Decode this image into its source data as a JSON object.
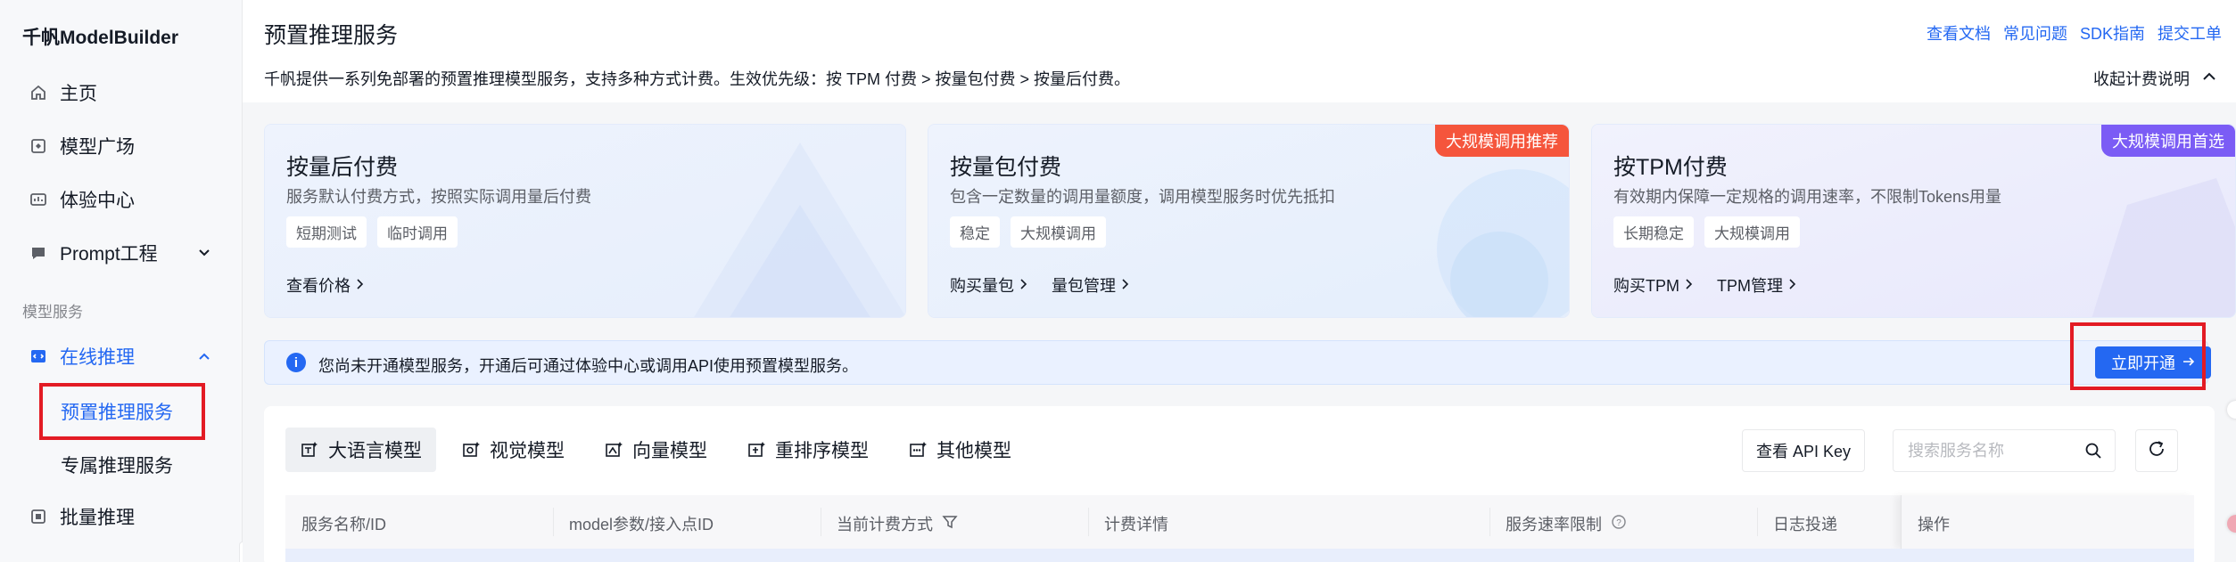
{
  "sidebar": {
    "brand": "千帆ModelBuilder",
    "items": [
      {
        "label": "主页",
        "icon": "home-icon"
      },
      {
        "label": "模型广场",
        "icon": "model-square-icon"
      },
      {
        "label": "体验中心",
        "icon": "experience-icon"
      },
      {
        "label": "Prompt工程",
        "icon": "prompt-icon"
      }
    ],
    "section_label": "模型服务",
    "online_inference": {
      "label": "在线推理",
      "icon": "code-icon"
    },
    "sub_items": [
      "预置推理服务",
      "专属推理服务"
    ],
    "batch": {
      "label": "批量推理",
      "icon": "batch-icon"
    }
  },
  "header": {
    "title": "预置推理服务",
    "links": [
      "查看文档",
      "常见问题",
      "SDK指南",
      "提交工单"
    ],
    "description": "千帆提供一系列免部署的预置推理模型服务，支持多种方式计费。生效优先级：按 TPM 付费 > 按量包付费 > 按量后付费。",
    "collapse_label": "收起计费说明"
  },
  "cards": [
    {
      "title": "按量后付费",
      "desc": "服务默认付费方式，按照实际调用量后付费",
      "tags": [
        "短期测试",
        "临时调用"
      ],
      "links": [
        "查看价格"
      ],
      "badge": ""
    },
    {
      "title": "按量包付费",
      "desc": "包含一定数量的调用量额度，调用模型服务时优先抵扣",
      "tags": [
        "稳定",
        "大规模调用"
      ],
      "links": [
        "购买量包",
        "量包管理"
      ],
      "badge": "大规模调用推荐"
    },
    {
      "title": "按TPM付费",
      "desc": "有效期内保障一定规格的调用速率，不限制Tokens用量",
      "tags": [
        "长期稳定",
        "大规模调用"
      ],
      "links": [
        "购买TPM",
        "TPM管理"
      ],
      "badge": "大规模调用首选"
    }
  ],
  "alert": {
    "text": "您尚未开通模型服务，开通后可通过体验中心或调用API使用预置模型服务。",
    "button": "立即开通"
  },
  "model_tabs": [
    "大语言模型",
    "视觉模型",
    "向量模型",
    "重排序模型",
    "其他模型"
  ],
  "toolbar": {
    "api_key_label": "查看 API Key",
    "search_placeholder": "搜索服务名称"
  },
  "table": {
    "columns": [
      "服务名称/ID",
      "model参数/接入点ID",
      "当前计费方式",
      "计费详情",
      "服务速率限制",
      "日志投递",
      "操作"
    ]
  },
  "colors": {
    "accent": "#2468f2",
    "badge_orange": "#f5553c",
    "badge_purple": "#7b5cf5",
    "highlight_red": "#e31b24"
  }
}
